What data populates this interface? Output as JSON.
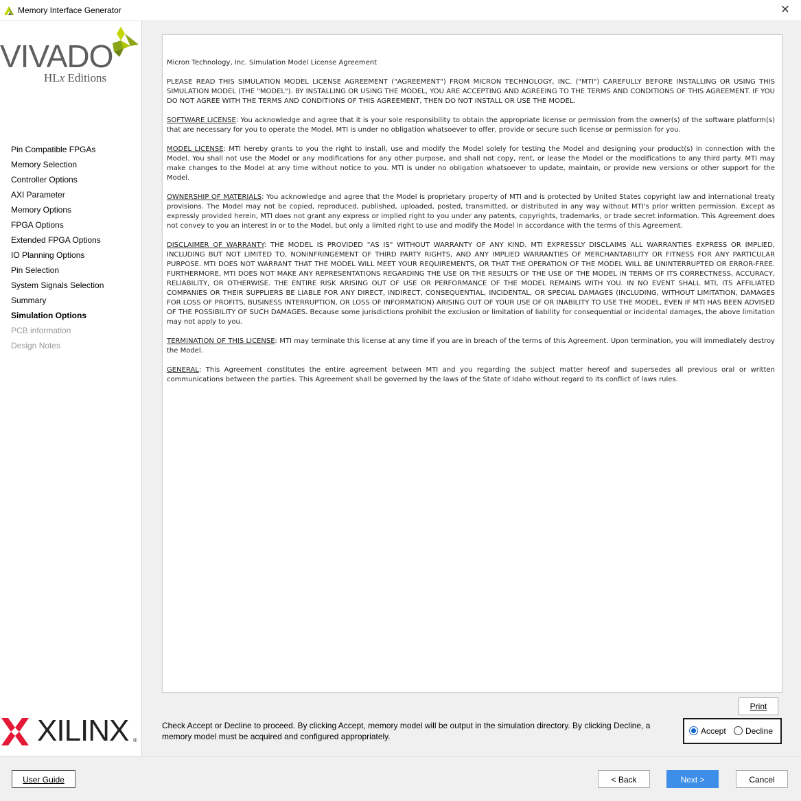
{
  "window": {
    "title": "Memory Interface Generator",
    "close_glyph": "✕",
    "icon": "xilinx-app-icon"
  },
  "sidebar": {
    "logo": {
      "word": "VIVADO",
      "trademark": "®",
      "sub_prefix": "HL",
      "sub_italic": "x",
      "sub_suffix": " Editions"
    },
    "items": [
      {
        "label": "Pin Compatible FPGAs",
        "state": "normal"
      },
      {
        "label": "Memory Selection",
        "state": "normal"
      },
      {
        "label": "Controller Options",
        "state": "normal"
      },
      {
        "label": "AXI Parameter",
        "state": "normal"
      },
      {
        "label": "Memory Options",
        "state": "normal"
      },
      {
        "label": "FPGA Options",
        "state": "normal"
      },
      {
        "label": "Extended FPGA Options",
        "state": "normal"
      },
      {
        "label": "IO Planning Options",
        "state": "normal"
      },
      {
        "label": "Pin Selection",
        "state": "normal"
      },
      {
        "label": "System Signals Selection",
        "state": "normal"
      },
      {
        "label": "Summary",
        "state": "normal"
      },
      {
        "label": "Simulation Options",
        "state": "active"
      },
      {
        "label": "PCB information",
        "state": "disabled"
      },
      {
        "label": "Design Notes",
        "state": "disabled"
      }
    ],
    "brand": {
      "word": "XILINX",
      "registered": "®"
    }
  },
  "license": {
    "heading": "Micron Technology, Inc. Simulation Model License Agreement",
    "intro": "PLEASE READ THIS SIMULATION MODEL LICENSE AGREEMENT (\"AGREEMENT\") FROM MICRON TECHNOLOGY, INC. (\"MTI\") CAREFULLY BEFORE INSTALLING OR USING THIS SIMULATION MODEL (THE \"MODEL\"). BY INSTALLING OR USING THE MODEL, YOU ARE ACCEPTING AND AGREEING TO THE TERMS AND CONDITIONS OF THIS AGREEMENT. IF YOU DO NOT AGREE WITH THE TERMS AND CONDITIONS OF THIS AGREEMENT, THEN DO NOT INSTALL OR USE THE MODEL.",
    "sections": [
      {
        "title": "SOFTWARE LICENSE",
        "body": ": You acknowledge and agree that it is your sole responsibility to obtain the appropriate license or permission from the owner(s) of the software platform(s) that are necessary for you to operate the Model. MTI is under no obligation whatsoever to offer, provide or secure such license or permission for you."
      },
      {
        "title": "MODEL LICENSE",
        "body": ": MTI hereby grants to you the right to install, use and modify the Model solely for testing the Model and designing your product(s) in connection with the Model. You shall not use the Model or any modifications for any other purpose, and shall not copy, rent, or lease the Model or the modifications to any third party. MTI may make changes to the Model at any time without notice to you. MTI is under no obligation whatsoever to update, maintain, or provide new versions or other support for the Model."
      },
      {
        "title": "OWNERSHIP OF MATERIALS",
        "body": ": You acknowledge and agree that the Model is proprietary property of MTI and is protected by United States copyright law and international treaty provisions. The Model may not be copied, reproduced, published, uploaded, posted, transmitted, or distributed in any way without MTI's prior written permission. Except as expressly provided herein, MTI does not grant any express or implied right to you under any patents, copyrights, trademarks, or trade secret information. This Agreement does not convey to you an interest in or to the Model, but only a limited right to use and modify the Model in accordance with the terms of this Agreement."
      },
      {
        "title": "DISCLAIMER OF WARRANTY",
        "body": ": THE MODEL IS PROVIDED \"AS IS\" WITHOUT WARRANTY OF ANY KIND. MTI EXPRESSLY DISCLAIMS ALL WARRANTIES EXPRESS OR IMPLIED, INCLUDING BUT NOT LIMITED TO, NONINFRINGEMENT OF THIRD PARTY RIGHTS, AND ANY IMPLIED WARRANTIES OF MERCHANTABILITY OR FITNESS FOR ANY PARTICULAR PURPOSE. MTI DOES NOT WARRANT THAT THE MODEL WILL MEET YOUR REQUIREMENTS, OR THAT THE OPERATION OF THE MODEL WILL BE UNINTERRUPTED OR ERROR-FREE. FURTHERMORE, MTI DOES NOT MAKE ANY REPRESENTATIONS REGARDING THE USE OR THE RESULTS OF THE USE OF THE MODEL IN TERMS OF ITS CORRECTNESS, ACCURACY, RELIABILITY, OR OTHERWISE. THE ENTIRE RISK ARISING OUT OF USE OR PERFORMANCE OF THE MODEL REMAINS WITH YOU. IN NO EVENT SHALL MTI, ITS AFFILIATED COMPANIES OR THEIR SUPPLIERS BE LIABLE FOR ANY DIRECT, INDIRECT, CONSEQUENTIAL, INCIDENTAL, OR SPECIAL DAMAGES (INCLUDING, WITHOUT LIMITATION, DAMAGES FOR LOSS OF PROFITS, BUSINESS INTERRUPTION, OR LOSS OF INFORMATION) ARISING OUT OF YOUR USE OF OR INABILITY TO USE THE MODEL, EVEN IF MTI HAS BEEN ADVISED OF THE POSSIBILITY OF SUCH DAMAGES. Because some jurisdictions prohibit the exclusion or limitation of liability for consequential or incidental damages, the above limitation may not apply to you."
      },
      {
        "title": "TERMINATION OF THIS LICENSE",
        "body": ": MTI may terminate this license at any time if you are in breach of the terms of this Agreement. Upon termination, you will immediately destroy the Model."
      },
      {
        "title": "GENERAL",
        "body": ": This Agreement constitutes the entire agreement between MTI and you regarding the subject matter hereof and supersedes all previous oral or written communications between the parties. This Agreement shall be governed by the laws of the State of Idaho without regard to its conflict of laws rules."
      }
    ]
  },
  "print_button": {
    "label": "Print"
  },
  "instructions": "Check Accept or Decline to proceed. By clicking Accept, memory model will be output in the simulation directory. By clicking Decline, a memory model must be acquired and configured appropriately.",
  "choice": {
    "accept_label": "Accept",
    "decline_label": "Decline",
    "selected": "Accept"
  },
  "footer": {
    "user_guide": "User Guide",
    "back": "< Back",
    "next": "Next >",
    "cancel": "Cancel"
  },
  "colors": {
    "accent": "#3d8ee8",
    "radio_checked": "#0a63c9",
    "vivado_green_dark": "#8aa614",
    "vivado_green_light": "#c4d600",
    "xilinx_red": "#e31937"
  }
}
